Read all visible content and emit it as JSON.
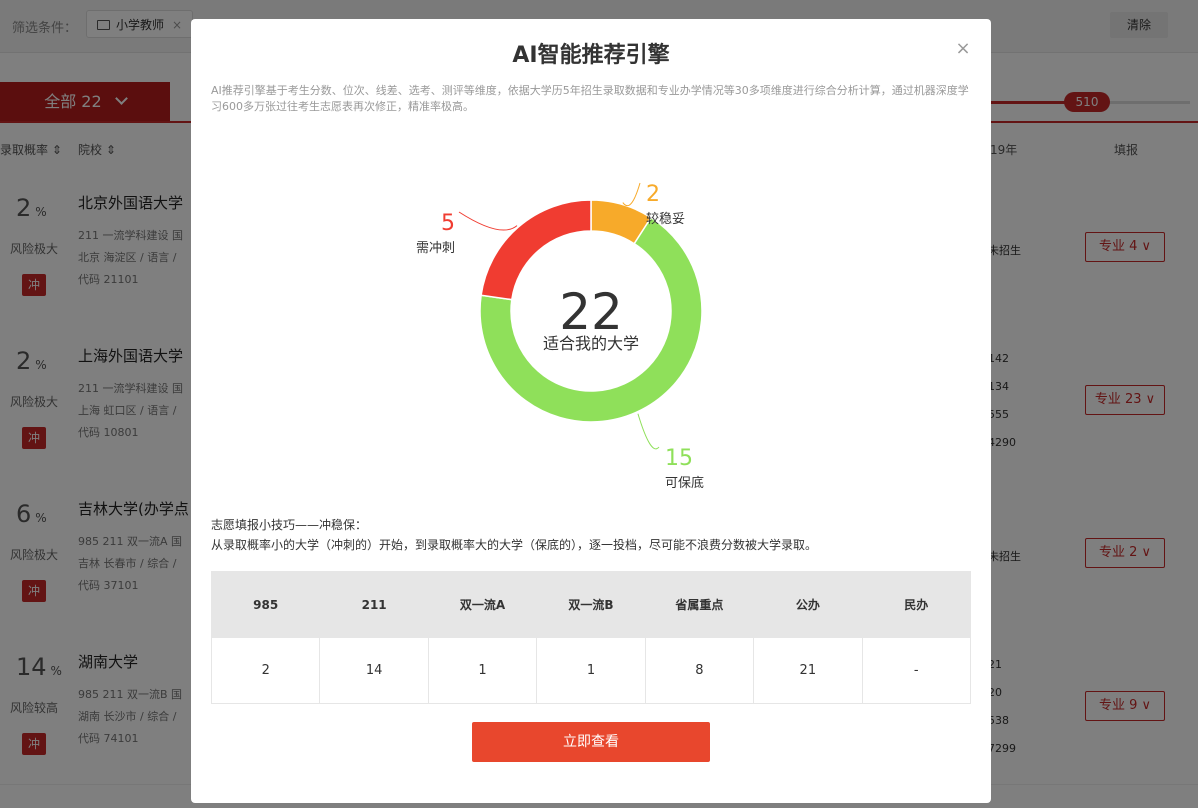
{
  "filter": {
    "label": "筛选条件：",
    "chip": "小学教师",
    "chip_close": "×",
    "clear": "清除"
  },
  "tabs": {
    "all_label": "全部 22",
    "chevron": "chevron-down-icon"
  },
  "score_slider": {
    "value": "510",
    "fill_fraction": 0.4
  },
  "table_header": {
    "prob": "录取概率",
    "school": "院校",
    "year": "19年",
    "fill": "填报"
  },
  "rows": [
    {
      "prob": "2",
      "unit": "%",
      "risk": "风险极大",
      "tag": "冲",
      "name": "北京外国语大学",
      "tags": "211 一流学科建设 国",
      "location": "北京 海淀区 / 语言 / ",
      "code": "代码 21101",
      "stats": [
        "未招生"
      ],
      "major": "专业 4"
    },
    {
      "prob": "2",
      "unit": "%",
      "risk": "风险极大",
      "tag": "冲",
      "name": "上海外国语大学",
      "tags": "211 一流学科建设 国",
      "location": "上海 虹口区 / 语言 / ",
      "code": "代码 10801",
      "stats": [
        "142",
        "134",
        "555",
        "4290"
      ],
      "major": "专业 23"
    },
    {
      "prob": "6",
      "unit": "%",
      "risk": "风险极大",
      "tag": "冲",
      "name": "吉林大学(办学点",
      "tags": "985 211 双一流A 国",
      "location": "吉林 长春市 / 综合 / ",
      "code": "代码 37101",
      "stats": [
        "未招生"
      ],
      "major": "专业 2"
    },
    {
      "prob": "14",
      "unit": "%",
      "risk": "风险较高",
      "tag": "冲",
      "name": "湖南大学",
      "tags": "985 211 双一流B 国",
      "location": "湖南 长沙市 / 综合 / ",
      "code": "代码 74101",
      "stats": [
        "21",
        "20",
        "538",
        "7299"
      ],
      "major": "专业 9"
    }
  ],
  "modal": {
    "title": "AI智能推荐引擎",
    "close": "×",
    "description": "AI推荐引擎基于考生分数、位次、线差、选考、测评等维度，依据大学历5年招生录取数据和专业办学情况等30多项维度进行综合分析计算，通过机器深度学习600多万张过往考生志愿表再次修正，精准率极高。",
    "tips_title": "志愿填报小技巧——冲稳保：",
    "tips_body": "从录取概率小的大学（冲刺的）开始，到录取概率大的大学（保底的），逐一投档，尽可能不浪费分数被大学录取。",
    "table": {
      "headers": [
        "985",
        "211",
        "双一流A",
        "双一流B",
        "省属重点",
        "公办",
        "民办"
      ],
      "values": [
        "2",
        "14",
        "1",
        "1",
        "8",
        "21",
        "-"
      ]
    },
    "cta": "立即查看"
  },
  "chart_data": {
    "type": "pie",
    "style": "donut",
    "center_value": "22",
    "center_label": "适合我的大学",
    "slices": [
      {
        "label": "较稳妥",
        "value": 2,
        "color": "#f7aa2a"
      },
      {
        "label": "可保底",
        "value": 15,
        "color": "#8fe05a"
      },
      {
        "label": "需冲刺",
        "value": 5,
        "color": "#f03c31"
      }
    ]
  }
}
